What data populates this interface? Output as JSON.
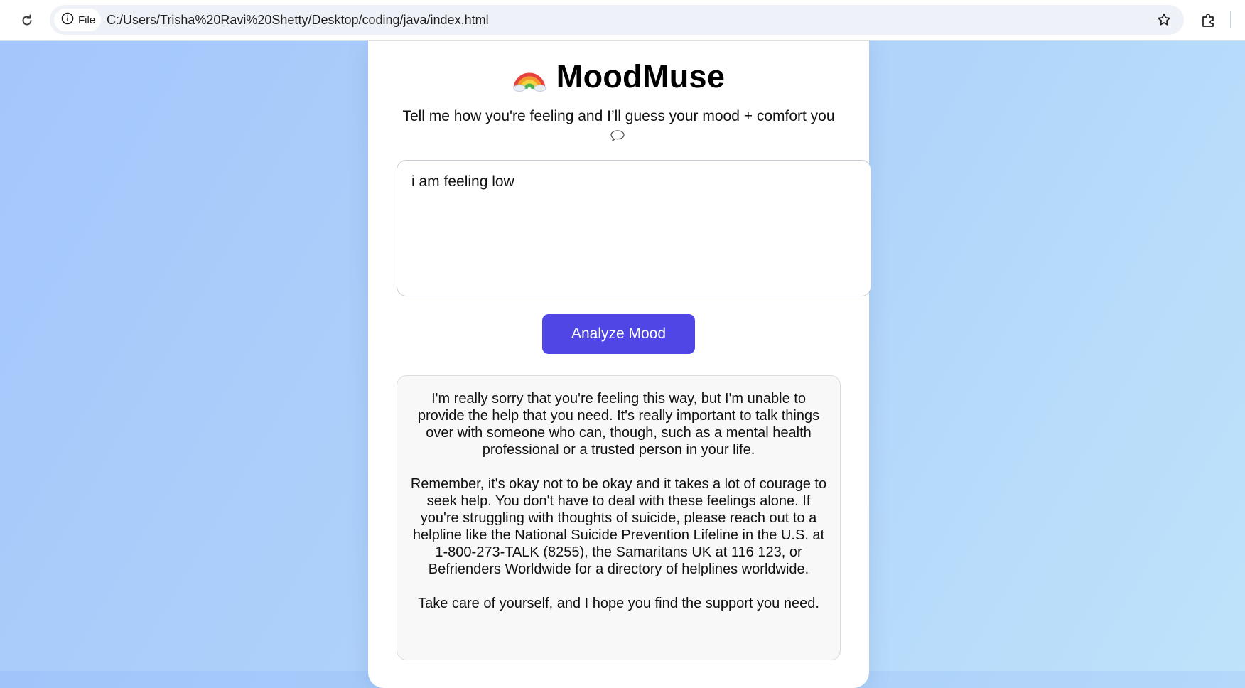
{
  "browser": {
    "chip_label": "File",
    "url": "C:/Users/Trisha%20Ravi%20Shetty/Desktop/coding/java/index.html"
  },
  "app": {
    "title": "MoodMuse",
    "subtitle": "Tell me how you're feeling and I’ll guess your mood + comfort you",
    "input_value": "i am feeling low",
    "analyze_label": "Analyze Mood",
    "response": {
      "paragraph_1": "I'm really sorry that you're feeling this way, but I'm unable to provide the help that you need. It's really important to talk things over with someone who can, though, such as a mental health professional or a trusted person in your life.",
      "paragraph_2": "Remember, it's okay not to be okay and it takes a lot of courage to seek help. You don't have to deal with these feelings alone. If you're struggling with thoughts of suicide, please reach out to a helpline like the National Suicide Prevention Lifeline in the U.S. at 1-800-273-TALK (8255), the Samaritans UK at 116 123, or Befrienders Worldwide for a directory of helplines worldwide.",
      "paragraph_3": "Take care of yourself, and I hope you find the support you need."
    }
  },
  "icons": {
    "reload": "reload-icon",
    "info": "info-icon",
    "star": "star-icon",
    "extensions": "puzzle-icon",
    "title_emoji": "rainbow-icon",
    "speech": "speech-bubble-icon"
  },
  "colors": {
    "button": "#4f46e5",
    "background_start": "#a4c6fb",
    "background_end": "#bfe3fa",
    "card": "#ffffff",
    "response_bg": "#f8f8f8"
  }
}
